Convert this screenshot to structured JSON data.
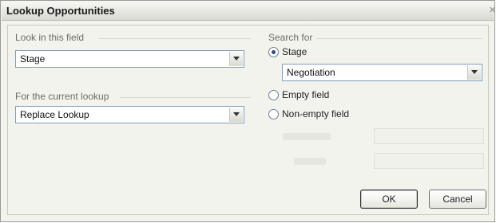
{
  "window": {
    "title": "Lookup Opportunities"
  },
  "look_in": {
    "group_label": "Look in this field",
    "selected": "Stage"
  },
  "current_lookup": {
    "group_label": "For the current lookup",
    "selected": "Replace Lookup"
  },
  "search_for": {
    "group_label": "Search for",
    "options": [
      {
        "label": "Stage",
        "selected": true
      },
      {
        "label": "Empty field",
        "selected": false
      },
      {
        "label": "Non-empty field",
        "selected": false
      }
    ],
    "stage_value": "Negotiation"
  },
  "buttons": {
    "ok_label": "OK",
    "cancel_label": "Cancel"
  }
}
